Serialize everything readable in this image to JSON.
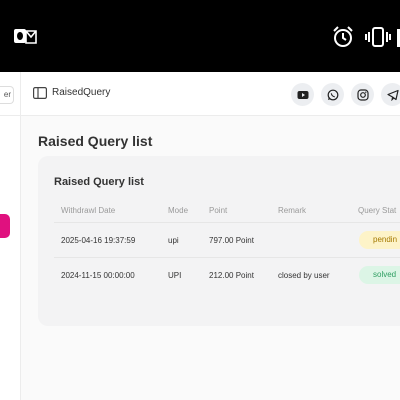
{
  "app": {
    "breadcrumb": "RaisedQuery",
    "sidebar_fragment": "er",
    "page_title": "Raised Query list"
  },
  "social": {
    "icons": [
      "youtube-icon",
      "whatsapp-icon",
      "instagram-icon",
      "telegram-icon"
    ]
  },
  "card": {
    "title": "Raised Query list",
    "headers": [
      "Withdrawl Date",
      "Mode",
      "Point",
      "Remark",
      "Query Stat"
    ],
    "rows": [
      {
        "date": "2025-04-16 19:37:59",
        "mode": "upi",
        "point": "797.00 Point",
        "remark": "",
        "status": "pendin"
      },
      {
        "date": "2024-11-15 00:00:00",
        "mode": "UPI",
        "point": "212.00 Point",
        "remark": "closed by user",
        "status": "solved"
      }
    ]
  },
  "colors": {
    "accent": "#e0117f",
    "pending_bg": "#fdf3c8",
    "solved_bg": "#dcf5e6"
  }
}
